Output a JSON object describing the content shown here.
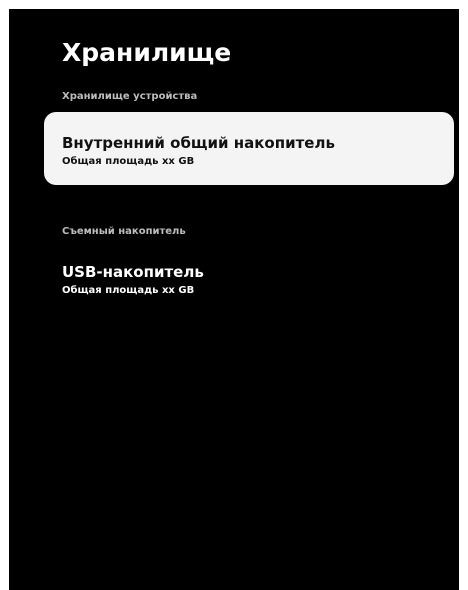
{
  "page": {
    "title": "Хранилище"
  },
  "sections": [
    {
      "header": "Хранилище устройства",
      "items": [
        {
          "title": "Внутренний общий накопитель",
          "subtitle": "Общая площадь xx GB",
          "focused": true
        }
      ]
    },
    {
      "header": "Съемный накопитель",
      "items": [
        {
          "title": "USB-накопитель",
          "subtitle": "Общая площадь xx GB",
          "focused": false
        }
      ]
    }
  ],
  "colors": {
    "background": "#000000",
    "focus_highlight": "#f4f4f4",
    "section_header": "#bdbdbd",
    "text": "#ffffff"
  }
}
